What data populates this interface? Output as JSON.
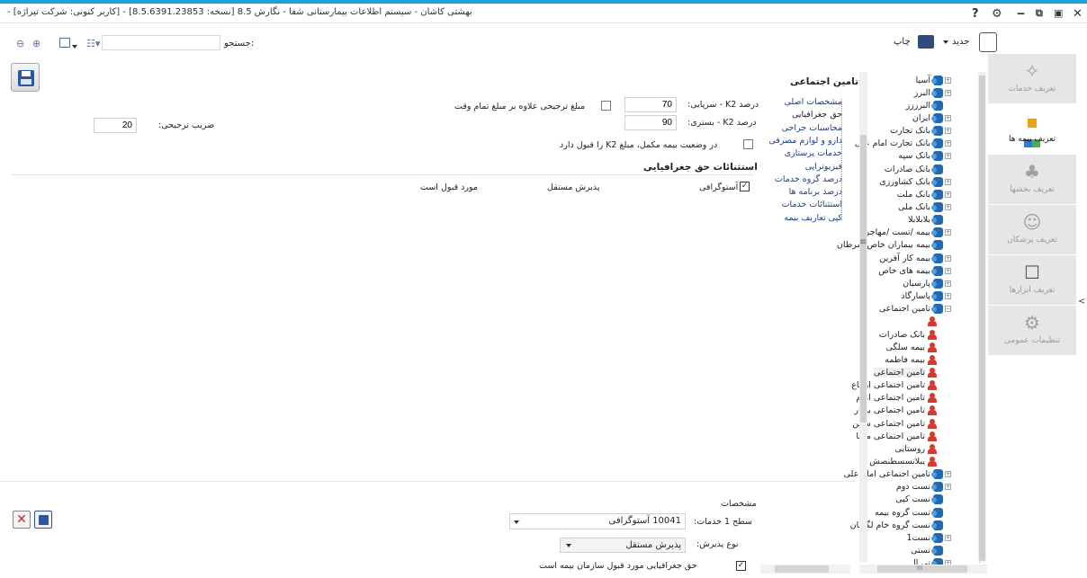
{
  "window": {
    "title": "- [کاربر کنونی: شرکت تیراژه] - بهشتی کاشان - سیستم اطلاعات بیمارستانی شفا - نگارش 8.5 [نسخه: 8.5.6391.23853]",
    "controls": {
      "close": "✕",
      "restore": "⧉",
      "maximize": "▣",
      "minimize": "‒",
      "settings": "⚙",
      "help": "?"
    }
  },
  "toolbar": {
    "new_label": "جدید",
    "print_label": "چاپ",
    "search_label": "جستجو:",
    "search_value": "",
    "icons": [
      "zoom-out-icon",
      "zoom-in-icon",
      "layout-icon",
      "list-view-icon"
    ]
  },
  "right_nav": {
    "items": [
      {
        "label": "تعریف خدمات",
        "icon": "✧",
        "active": false
      },
      {
        "label": "تعریف بیمه ها",
        "icon": "■",
        "active": true
      },
      {
        "label": "تعریف بخشها",
        "icon": "♣",
        "active": false
      },
      {
        "label": "تعریف پزشکان",
        "icon": "☺",
        "active": false
      },
      {
        "label": "تعریف ابزارها",
        "icon": "☐",
        "active": false
      },
      {
        "label": "تنظیمات عمومی",
        "icon": "⚙",
        "active": false
      }
    ],
    "collapse_glyph": "<"
  },
  "tree": {
    "items": [
      {
        "label": "آسیا",
        "type": "folder",
        "expander": "+"
      },
      {
        "label": "البرز",
        "type": "folder",
        "expander": "+"
      },
      {
        "label": "البرززز",
        "type": "folder",
        "expander": ""
      },
      {
        "label": "ایران",
        "type": "folder",
        "expander": "+"
      },
      {
        "label": "بانک تجارت",
        "type": "folder",
        "expander": "+"
      },
      {
        "label": "بانک تجارت امام علی",
        "type": "folder",
        "expander": "+"
      },
      {
        "label": "بانک سپه",
        "type": "folder",
        "expander": "+"
      },
      {
        "label": "بانک صادرات",
        "type": "folder",
        "expander": ""
      },
      {
        "label": "بانک کشاورزی",
        "type": "folder",
        "expander": "+"
      },
      {
        "label": "بانک ملت",
        "type": "folder",
        "expander": "+"
      },
      {
        "label": "بانک ملی",
        "type": "folder",
        "expander": "+"
      },
      {
        "label": "بلابلابلا",
        "type": "folder",
        "expander": ""
      },
      {
        "label": "بیمه /تست /مهاجر",
        "type": "folder",
        "expander": "+"
      },
      {
        "label": "بیمه بیماران خاص سرطان",
        "type": "folder",
        "expander": ""
      },
      {
        "label": "بیمه کار آفرین",
        "type": "folder",
        "expander": "+"
      },
      {
        "label": "بیمه های خاص",
        "type": "folder",
        "expander": "+"
      },
      {
        "label": "پارسیان",
        "type": "folder",
        "expander": "+"
      },
      {
        "label": "پاسارگاد",
        "type": "folder",
        "expander": "+"
      },
      {
        "label": "تامین اجتماعی",
        "type": "folder",
        "expander": "−"
      },
      {
        "label": "",
        "type": "person",
        "expander": ""
      },
      {
        "label": "بانک صادرات",
        "type": "person",
        "expander": ""
      },
      {
        "label": "بیمه سلگی",
        "type": "person",
        "expander": ""
      },
      {
        "label": "بیمه فاطمه",
        "type": "person",
        "expander": ""
      },
      {
        "label": "تامین اجتماعی",
        "type": "person",
        "expander": "",
        "selected": true
      },
      {
        "label": "تامین اجتماعی ارجاع",
        "type": "person",
        "expander": ""
      },
      {
        "label": "تامین اجتماعی امام",
        "type": "person",
        "expander": ""
      },
      {
        "label": "تامین اجتماعی بیمار",
        "type": "person",
        "expander": ""
      },
      {
        "label": "تامین اجتماعی سمن",
        "type": "person",
        "expander": ""
      },
      {
        "label": "تامین اجتماعی مشا",
        "type": "person",
        "expander": ""
      },
      {
        "label": "روستایی",
        "type": "person",
        "expander": ""
      },
      {
        "label": "یبلاتسسطنصش",
        "type": "person",
        "expander": ""
      },
      {
        "label": "تامین اجتماعی امام علی",
        "type": "folder",
        "expander": "+"
      },
      {
        "label": "تست دوم",
        "type": "folder",
        "expander": "+"
      },
      {
        "label": "تست کپی",
        "type": "folder",
        "expander": ""
      },
      {
        "label": "تست گروه بیمه",
        "type": "folder",
        "expander": ""
      },
      {
        "label": "تست گروه خام لگزیان",
        "type": "folder",
        "expander": ""
      },
      {
        "label": "تست1",
        "type": "folder",
        "expander": "+"
      },
      {
        "label": "تستی",
        "type": "folder",
        "expander": ""
      },
      {
        "label": "تی ال",
        "type": "folder",
        "expander": "+"
      }
    ],
    "hscroll_grip": "III"
  },
  "side_links": {
    "title": "تامین اجتماعی",
    "items": [
      {
        "label": "مشخصات اصلی",
        "current": false
      },
      {
        "label": "حق جغرافیایی",
        "current": true
      },
      {
        "label": "محاسبات جراحی",
        "current": false
      },
      {
        "label": "دارو و لوازم مصرفی",
        "current": false
      },
      {
        "label": "خدمات پرستاری",
        "current": false
      },
      {
        "label": "فیزیوتراپی",
        "current": false
      },
      {
        "label": "درصد گروه خدمات",
        "current": false
      },
      {
        "label": "درصد برنامه ها",
        "current": false
      },
      {
        "label": "استثنائات خدمات",
        "current": false
      },
      {
        "label": "کپی تعاریف بیمه",
        "current": false
      }
    ],
    "splitter_glyph": "≡"
  },
  "form": {
    "k2_outpatient_label": "درصد K2 - سرپایی:",
    "k2_outpatient_value": "70",
    "k2_inpatient_label": "درصد K2 - بستری:",
    "k2_inpatient_value": "90",
    "preferential_amount_label": "مبلغ ترجیحی علاوه بر مبلغ تمام وقت",
    "preferential_amount_checked": false,
    "supplementary_label": "در وضعیت بیمه مکمل، مبلغ K2 را قبول دارد",
    "supplementary_checked": false,
    "coefficient_label": "ضریب ترجیحی:",
    "coefficient_value": "20"
  },
  "exceptions": {
    "title": "استثنائات حق جغرافیایی",
    "columns": [
      "",
      "پذیرش مستقل",
      "مورد قبول است"
    ],
    "rows": [
      {
        "checked": true,
        "name": "آستوگرافی",
        "admission": "پذیرش مستقل",
        "accepted": "مورد قبول است"
      }
    ]
  },
  "details": {
    "title": "مشخصات",
    "level1_label": "سطح 1 خدمات:",
    "level1_value": "10041 آستوگرافی",
    "admission_type_label": "نوع پذیرش:",
    "admission_type_value": "پذیرش مستقل",
    "accepted_checkbox_label": "حق جغرافیایی مورد قبول سازمان بیمه است",
    "accepted_checked": true
  },
  "colors": {
    "accent": "#1aa0dd",
    "link": "#1d3f8c",
    "nav_bg": "#e6e6e6",
    "folder_icon": "#2466b8",
    "person_icon": "#d9392c",
    "delete_red": "#c0242c",
    "save_blue": "#2a56a8"
  }
}
